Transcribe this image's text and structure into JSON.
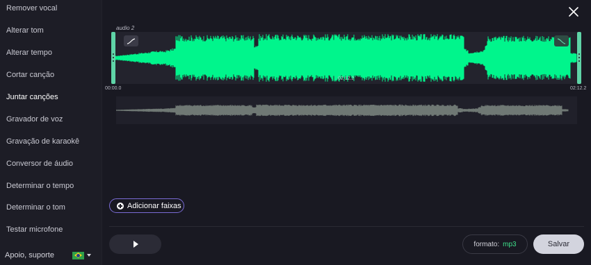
{
  "sidebar": {
    "items": [
      {
        "label": "Remover vocal",
        "active": false
      },
      {
        "label": "Alterar tom",
        "active": false
      },
      {
        "label": "Alterar tempo",
        "active": false
      },
      {
        "label": "Cortar canção",
        "active": false
      },
      {
        "label": "Juntar canções",
        "active": true
      },
      {
        "label": "Gravador de voz",
        "active": false
      },
      {
        "label": "Gravação de karaokê",
        "active": false
      },
      {
        "label": "Conversor de áudio",
        "active": false
      },
      {
        "label": "Determinar o tempo",
        "active": false
      },
      {
        "label": "Determinar o tom",
        "active": false
      },
      {
        "label": "Testar microfone",
        "active": false
      }
    ],
    "support_label": "Apoio, suporte",
    "language_icon": "brazil-flag-icon"
  },
  "editor": {
    "track_name": "audio 2",
    "start_time": "00:00.0",
    "current_time": "02:12.2",
    "end_time": "02:12.2",
    "fade_in_icon": "fade-in-icon",
    "fade_out_icon": "fade-out-icon",
    "close_icon": "close-icon"
  },
  "actions": {
    "add_tracks_label": "Adicionar faixas",
    "play_icon": "play-icon",
    "format_label": "formato:",
    "format_value": "mp3",
    "save_label": "Salvar"
  },
  "colors": {
    "waveform": "#00f58c",
    "overview_waveform": "#6f7874",
    "handle": "#5fd4a7",
    "accent_border": "#7a6cd6",
    "format_value": "#3ee08a"
  }
}
